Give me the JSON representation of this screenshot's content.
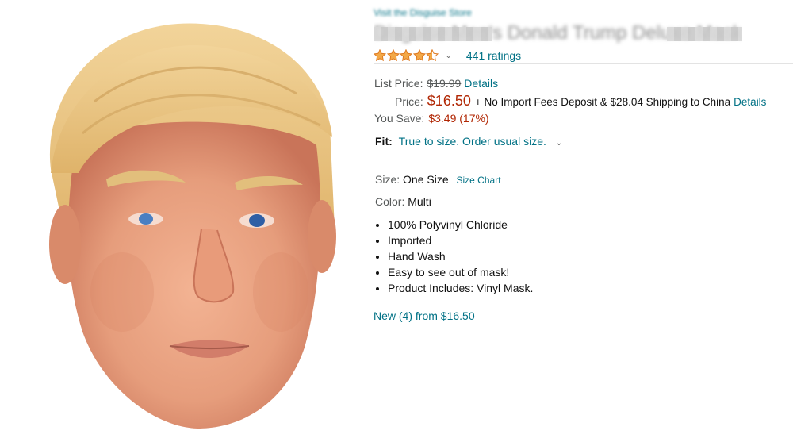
{
  "product": {
    "store_link": "Visit the Disguise Store",
    "title": "Disguise Men's Donald Trump Deluxe Mask",
    "rating_value": 4.5,
    "ratings_count": "441 ratings",
    "list_price_label": "List Price:",
    "list_price": "$19.99",
    "details_label": "Details",
    "price_label": "Price:",
    "price": "$16.50",
    "shipping_text": "+ No Import Fees Deposit & $28.04 Shipping to China",
    "shipping_details": "Details",
    "you_save_label": "You Save:",
    "you_save": "$3.49 (17%)",
    "fit_label": "Fit:",
    "fit_value": "True to size. Order usual size.",
    "size_label": "Size:",
    "size_value": "One Size",
    "size_chart": "Size Chart",
    "color_label": "Color:",
    "color_value": "Multi",
    "bullets": [
      "100% Polyvinyl Chloride",
      "Imported",
      "Hand Wash",
      "Easy to see out of mask!",
      "Product Includes: Vinyl Mask."
    ],
    "new_offers": "New (4) from $16.50"
  },
  "colors": {
    "link": "#007185",
    "price": "#B12704",
    "star": "#F3A847",
    "muted": "#565959"
  },
  "icons": {
    "star": "star-icon",
    "dropdown": "chevron-down-icon"
  }
}
